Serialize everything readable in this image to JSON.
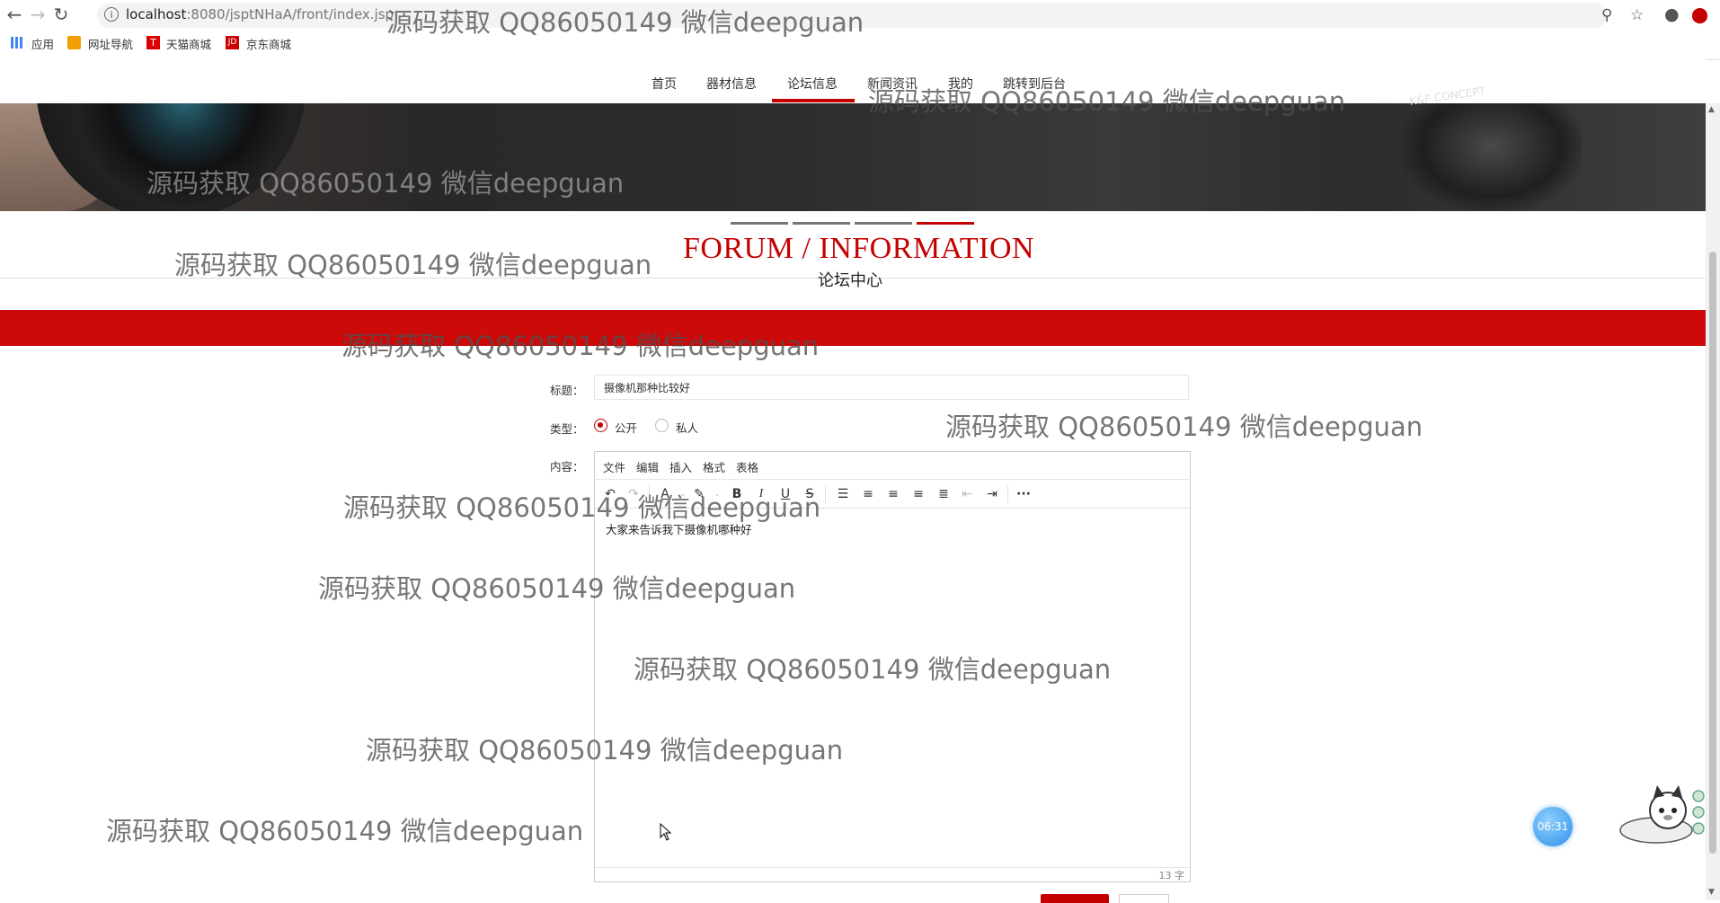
{
  "browser": {
    "url_host": "localhost",
    "url_rest": ":8080/jsptNHaA/front/index.jsp",
    "icons": [
      "back-icon",
      "forward-icon",
      "reload-icon",
      "info-icon",
      "zoom-icon",
      "star-icon",
      "account-icon",
      "extension-icon"
    ],
    "bookmarks": [
      {
        "label": "应用",
        "icon": "apps-grid-icon"
      },
      {
        "label": "网址导航",
        "icon": "folder-icon"
      },
      {
        "label": "天猫商城",
        "icon": "tmall-icon"
      },
      {
        "label": "京东商城",
        "icon": "jd-icon"
      }
    ]
  },
  "nav": {
    "items": [
      "首页",
      "器材信息",
      "论坛信息",
      "新闻资讯",
      "我的",
      "跳转到后台"
    ],
    "active_index": 2
  },
  "banner": {
    "brand_text": "K&F CONCEPT"
  },
  "section": {
    "title": "FORUM / INFORMATION",
    "subtitle": "论坛中心"
  },
  "form": {
    "title_label": "标题：",
    "title_value": "摄像机那种比较好",
    "type_label": "类型：",
    "type_options": [
      "公开",
      "私人"
    ],
    "type_selected": "公开",
    "content_label": "内容：",
    "editor_menus": [
      "文件",
      "编辑",
      "插入",
      "格式",
      "表格"
    ],
    "editor_content": "大家来告诉我下摄像机哪种好",
    "word_count": "13 字"
  },
  "widgets": {
    "timer": "06:31"
  },
  "watermark": "源码获取 QQ86050149 微信deepguan",
  "colors": {
    "brand_red": "#c40000",
    "bar_red": "#cc0a0a",
    "timer_blue": "#2f8fe8"
  }
}
